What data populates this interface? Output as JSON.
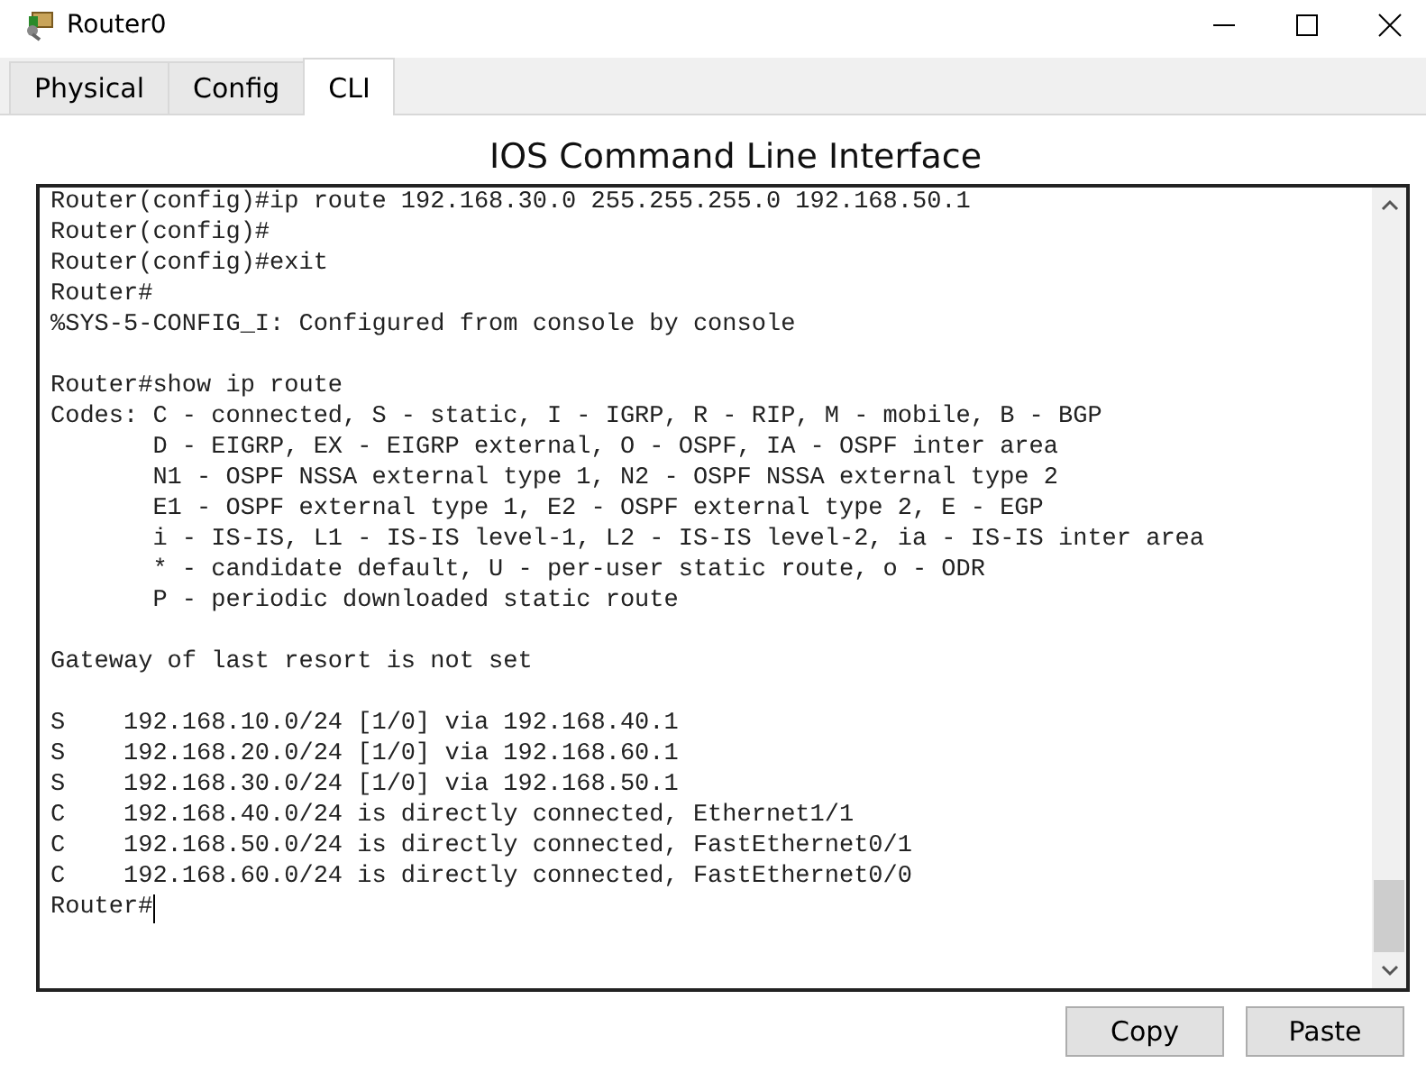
{
  "window": {
    "title": "Router0"
  },
  "tabs": [
    {
      "label": "Physical",
      "selected": false
    },
    {
      "label": "Config",
      "selected": false
    },
    {
      "label": "CLI",
      "selected": true
    }
  ],
  "heading": "IOS Command Line Interface",
  "terminal": {
    "blocks": [
      [
        "Router(config)#ip route 192.168.30.0 255.255.255.0 192.168.50.1",
        "Router(config)#",
        "Router(config)#exit",
        "Router#",
        "%SYS-5-CONFIG_I: Configured from console by console"
      ],
      [
        "Router#show ip route",
        "Codes: C - connected, S - static, I - IGRP, R - RIP, M - mobile, B - BGP",
        "       D - EIGRP, EX - EIGRP external, O - OSPF, IA - OSPF inter area",
        "       N1 - OSPF NSSA external type 1, N2 - OSPF NSSA external type 2",
        "       E1 - OSPF external type 1, E2 - OSPF external type 2, E - EGP",
        "       i - IS-IS, L1 - IS-IS level-1, L2 - IS-IS level-2, ia - IS-IS inter area",
        "       * - candidate default, U - per-user static route, o - ODR",
        "       P - periodic downloaded static route"
      ],
      [
        "Gateway of last resort is not set"
      ],
      [
        "S    192.168.10.0/24 [1/0] via 192.168.40.1",
        "S    192.168.20.0/24 [1/0] via 192.168.60.1",
        "S    192.168.30.0/24 [1/0] via 192.168.50.1",
        "C    192.168.40.0/24 is directly connected, Ethernet1/1",
        "C    192.168.50.0/24 is directly connected, FastEthernet0/1",
        "C    192.168.60.0/24 is directly connected, FastEthernet0/0",
        "Router#"
      ]
    ]
  },
  "buttons": [
    "Copy",
    "Paste"
  ]
}
